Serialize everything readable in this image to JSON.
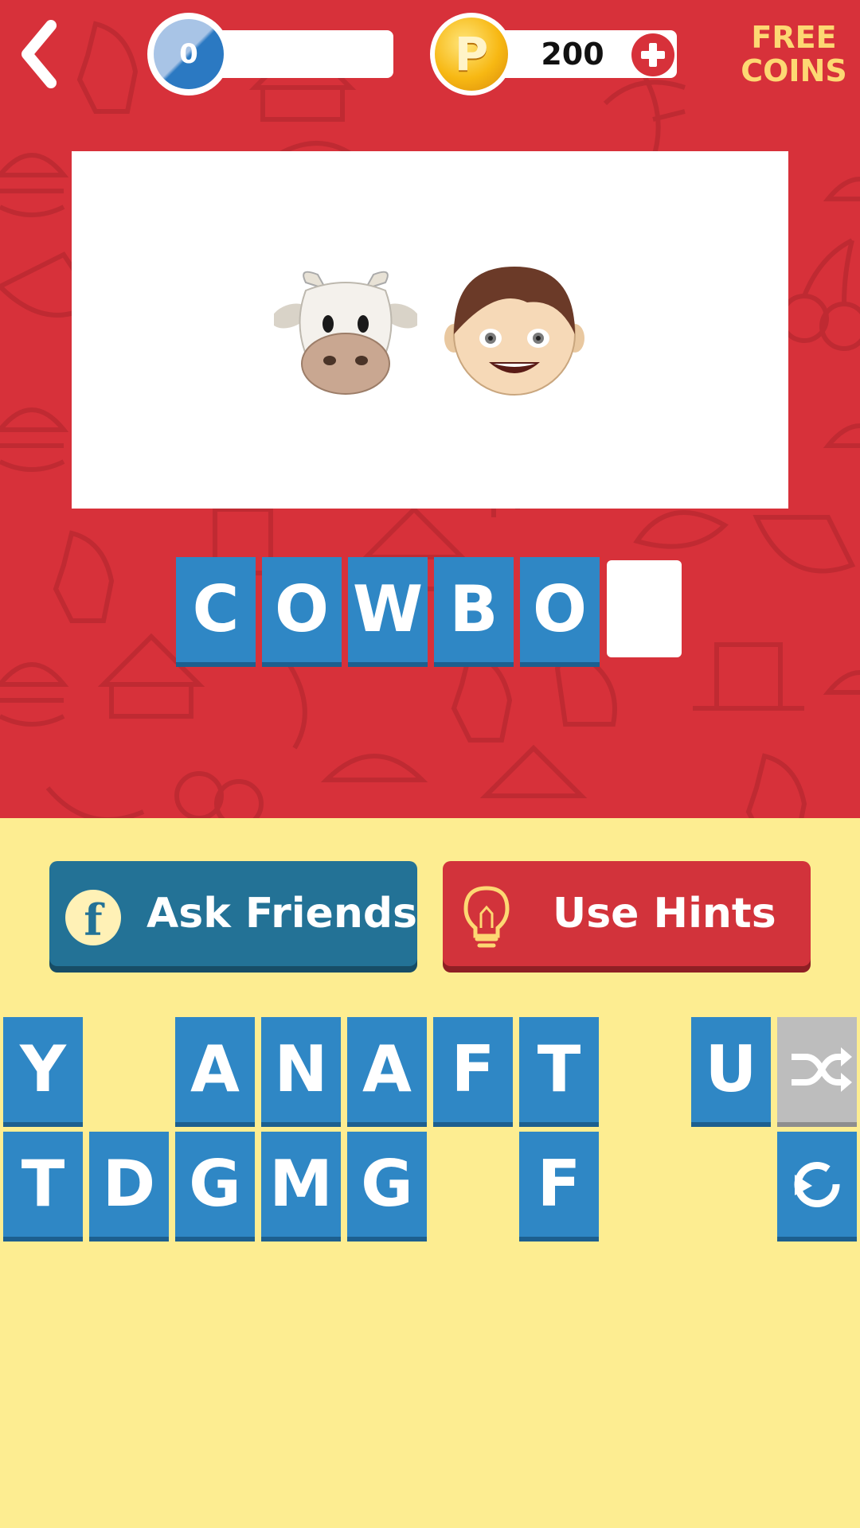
{
  "header": {
    "back_icon": "chevron-left-icon",
    "level": "0",
    "coins": "200",
    "coin_symbol": "P",
    "free_coins_line1": "FREE",
    "free_coins_line2": "COINS"
  },
  "puzzle": {
    "emojis": [
      "cow-face-emoji",
      "boy-face-emoji"
    ]
  },
  "answer": {
    "slots": [
      "C",
      "O",
      "W",
      "B",
      "O",
      ""
    ]
  },
  "actions": {
    "ask_friends": "Ask Friends",
    "use_hints": "Use Hints"
  },
  "letters": {
    "row1": [
      "Y",
      "",
      "A",
      "N",
      "A",
      "F",
      "T",
      "",
      "U"
    ],
    "row2": [
      "T",
      "D",
      "G",
      "M",
      "G",
      "",
      "F"
    ]
  },
  "colors": {
    "top_bg": "#d7313a",
    "bottom_bg": "#fded91",
    "tile": "#2f87c5",
    "ask_button": "#237296",
    "hint_button": "#d2333b",
    "shuffle_tile": "#bdbdbd",
    "free_coins_text": "#fdd873"
  }
}
